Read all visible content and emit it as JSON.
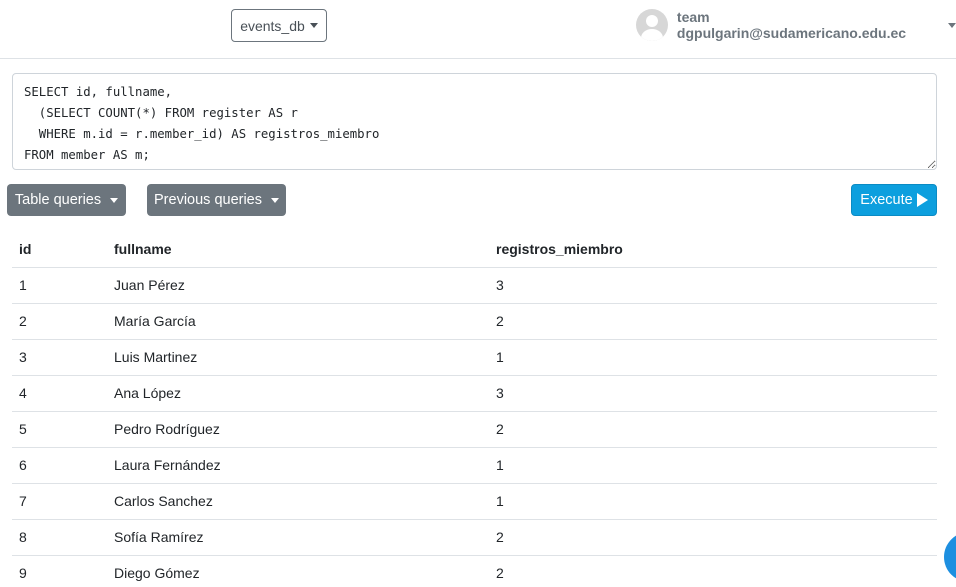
{
  "header": {
    "database_select": "events_db",
    "user_label": "team dgpulgarin@sudamericano.edu.ec"
  },
  "editor": {
    "query": "SELECT id, fullname,\n  (SELECT COUNT(*) FROM register AS r\n  WHERE m.id = r.member_id) AS registros_miembro\nFROM member AS m;"
  },
  "toolbar": {
    "table_queries_label": "Table queries",
    "previous_queries_label": "Previous queries",
    "execute_label": "Execute"
  },
  "results": {
    "columns": [
      "id",
      "fullname",
      "registros_miembro"
    ],
    "rows": [
      [
        "1",
        "Juan Pérez",
        "3"
      ],
      [
        "2",
        "María García",
        "2"
      ],
      [
        "3",
        "Luis Martinez",
        "1"
      ],
      [
        "4",
        "Ana López",
        "3"
      ],
      [
        "5",
        "Pedro Rodríguez",
        "2"
      ],
      [
        "6",
        "Laura Fernández",
        "1"
      ],
      [
        "7",
        "Carlos Sanchez",
        "1"
      ],
      [
        "8",
        "Sofía Ramírez",
        "2"
      ],
      [
        "9",
        "Diego Gómez",
        "2"
      ]
    ]
  },
  "colors": {
    "secondary": "#6c757d",
    "primary_execute": "#0d9fde",
    "fab": "#1d8fe0"
  }
}
